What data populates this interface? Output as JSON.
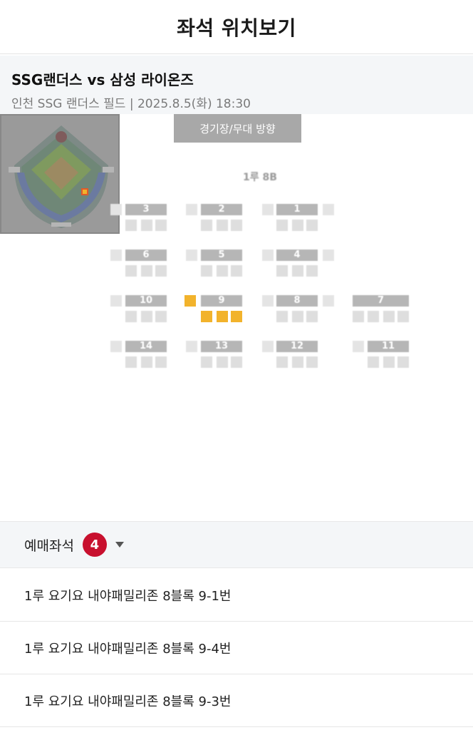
{
  "header": {
    "title": "좌석 위치보기"
  },
  "match": {
    "title": "SSG랜더스 vs 삼성 라이온즈",
    "info": "인천 SSG 랜더스 필드 | 2025.8.5(화) 18:30"
  },
  "stage_label": "경기장/무대 방향",
  "section_label": "1루 8B",
  "rows": [
    {
      "label": "3"
    },
    {
      "label": "2"
    },
    {
      "label": "1"
    },
    {
      "label": "6"
    },
    {
      "label": "5"
    },
    {
      "label": "4"
    },
    {
      "label": "10"
    },
    {
      "label": "9"
    },
    {
      "label": "8"
    },
    {
      "label": "7"
    },
    {
      "label": "14"
    },
    {
      "label": "13"
    },
    {
      "label": "12"
    },
    {
      "label": "11"
    }
  ],
  "selected_seats": [
    "9-0",
    "9-1",
    "9-2",
    "9-3"
  ],
  "ticket": {
    "label": "예매좌석",
    "count": "4",
    "items": [
      "1루 요기요 내야패밀리존 8블록 9-1번",
      "1루 요기요 내야패밀리존 8블록 9-4번",
      "1루 요기요 내야패밀리존 8블록 9-3번"
    ]
  },
  "colors": {
    "accent_red": "#c8102e",
    "selected_seat": "#f2b32c",
    "seat_gray": "#dedede",
    "stage_gray": "#a8a8a8"
  }
}
